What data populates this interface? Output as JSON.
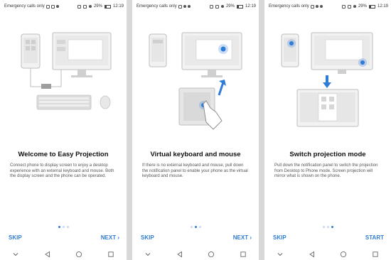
{
  "status_bar": {
    "carrier": "Emergency calls only",
    "battery": "29%",
    "time": "12:19"
  },
  "panels": [
    {
      "title": "Welcome to Easy Projection",
      "description": "Connect phone to display screen to enjoy a desktop experience with an external keyboard and mouse. Both the display screen and the phone can be operated.",
      "left_button": "SKIP",
      "right_button": "NEXT ›",
      "active_page": 0
    },
    {
      "title": "Virtual keyboard and mouse",
      "description": "If there is no external keyboard and mouse, pull down the notification panel to enable your phone as the virtual keyboard and mouse.",
      "left_button": "SKIP",
      "right_button": "NEXT ›",
      "active_page": 1
    },
    {
      "title": "Switch projection mode",
      "description": "Pull down the notification panel to switch the projection from Desktop to Phone mode. Screen projection will mirror what is shown on the phone.",
      "left_button": "SKIP",
      "right_button": "START",
      "active_page": 2
    }
  ],
  "page_count": 3,
  "colors": {
    "accent": "#2f7bd8",
    "illustration": "#e8e8e8",
    "outline": "#bdbdbd"
  },
  "nav_icons": [
    "chevron-down-icon",
    "back-icon",
    "home-icon",
    "recents-icon"
  ]
}
